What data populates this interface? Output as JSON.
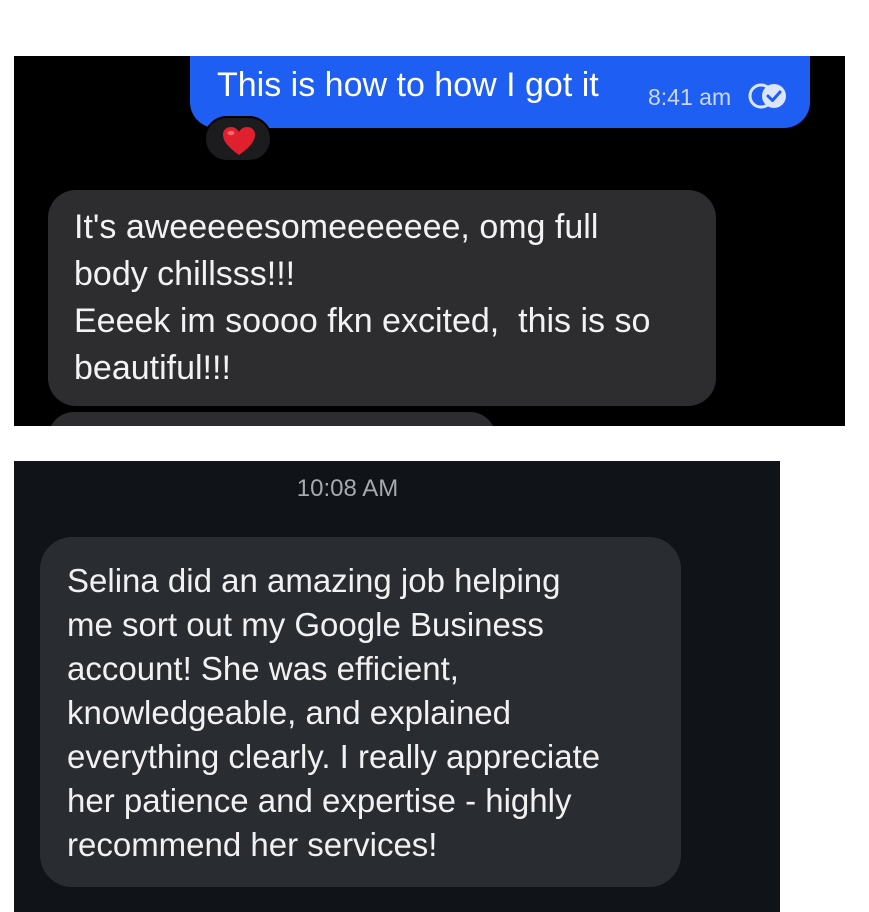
{
  "chat1": {
    "outgoing": {
      "text": "This is how to how I got it",
      "time": "8:41 am",
      "read_icon": "double-check-circle-icon",
      "reaction": "heart-emoji"
    },
    "incoming": {
      "lines": [
        "It's aweeeeesomeeeeeee, omg full",
        "body chillsss!!!",
        "Eeeek im soooo fkn excited,  this is so",
        "beautiful!!!"
      ]
    }
  },
  "chat2": {
    "timestamp": "10:08 AM",
    "message": {
      "lines": [
        "Selina did an amazing job helping",
        "me sort out my Google Business",
        "account! She was efficient,",
        "knowledgeable, and explained",
        "everything clearly. I really appreciate",
        "her patience and expertise - highly",
        "recommend her services!"
      ]
    }
  },
  "colors": {
    "outgoing_bubble": "#1f5ef2",
    "incoming_bubble": "#2d2d30",
    "chat1_background": "#000000",
    "chat2_background": "#101318",
    "chat2_bubble": "#292c31",
    "heart": "#e0202e"
  }
}
